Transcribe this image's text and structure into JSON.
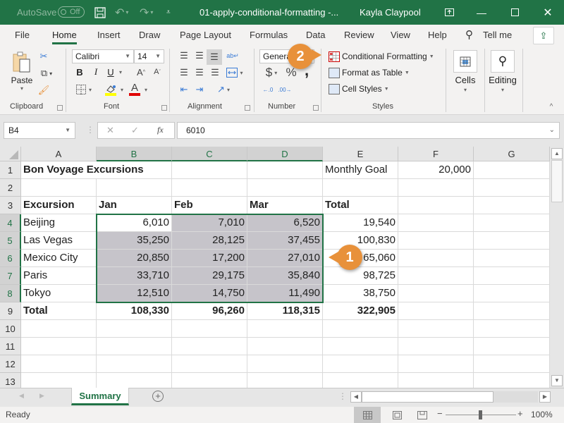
{
  "titlebar": {
    "autosave_label": "AutoSave",
    "autosave_state": "Off",
    "doc_title": "01-apply-conditional-formatting -...",
    "user_name": "Kayla Claypool",
    "icons": [
      "save-icon",
      "undo-icon",
      "redo-icon",
      "customize-qat-icon",
      "ribbon-display-icon",
      "minimize-icon",
      "maximize-icon",
      "close-icon"
    ]
  },
  "tabs": [
    {
      "label": "File"
    },
    {
      "label": "Home",
      "active": true
    },
    {
      "label": "Insert"
    },
    {
      "label": "Draw"
    },
    {
      "label": "Page Layout"
    },
    {
      "label": "Formulas"
    },
    {
      "label": "Data"
    },
    {
      "label": "Review"
    },
    {
      "label": "View"
    },
    {
      "label": "Help"
    }
  ],
  "tell_me": "Tell me",
  "ribbon": {
    "clipboard": {
      "label": "Clipboard",
      "paste": "Paste"
    },
    "font": {
      "label": "Font",
      "name": "Calibri",
      "size": "14",
      "bold": "B",
      "italic": "I",
      "underline": "U",
      "grow": "A",
      "shrink": "A",
      "font_color": "A"
    },
    "alignment": {
      "label": "Alignment"
    },
    "number": {
      "label": "Number",
      "format": "General",
      "currency": "$",
      "percent": "%",
      "comma": ","
    },
    "styles": {
      "label": "Styles",
      "conditional_formatting": "Conditional Formatting",
      "format_as_table": "Format as Table",
      "cell_styles": "Cell Styles"
    },
    "cells": {
      "label": "Cells"
    },
    "editing": {
      "label": "Editing"
    }
  },
  "formula_bar": {
    "name_box": "B4",
    "cancel": "✕",
    "enter": "✓",
    "fx": "fx",
    "value": "6010"
  },
  "columns": [
    "A",
    "B",
    "C",
    "D",
    "E",
    "F",
    "G"
  ],
  "rows": [
    "1",
    "2",
    "3",
    "4",
    "5",
    "6",
    "7",
    "8",
    "9",
    "10",
    "11",
    "12",
    "13"
  ],
  "sheet": {
    "title": "Bon Voyage Excursions",
    "goal_label": "Monthly Goal",
    "goal_value": "20,000",
    "headers": [
      "Excursion",
      "Jan",
      "Feb",
      "Mar",
      "Total"
    ],
    "data": [
      {
        "name": "Beijing",
        "jan": "6,010",
        "feb": "7,010",
        "mar": "6,520",
        "total": "19,540"
      },
      {
        "name": "Las Vegas",
        "jan": "35,250",
        "feb": "28,125",
        "mar": "37,455",
        "total": "100,830"
      },
      {
        "name": "Mexico City",
        "jan": "20,850",
        "feb": "17,200",
        "mar": "27,010",
        "total": "65,060"
      },
      {
        "name": "Paris",
        "jan": "33,710",
        "feb": "29,175",
        "mar": "35,840",
        "total": "98,725"
      },
      {
        "name": "Tokyo",
        "jan": "12,510",
        "feb": "14,750",
        "mar": "11,490",
        "total": "38,750"
      }
    ],
    "totals": {
      "label": "Total",
      "jan": "108,330",
      "feb": "96,260",
      "mar": "118,315",
      "total": "322,905"
    }
  },
  "sheet_tabs": [
    {
      "label": "Summary",
      "active": true
    }
  ],
  "status": {
    "ready": "Ready",
    "zoom": "100%"
  },
  "callouts": {
    "one": "1",
    "two": "2"
  },
  "colors": {
    "accent": "#217346",
    "highlight": "#c6c4ca",
    "callout": "#e8913a"
  }
}
